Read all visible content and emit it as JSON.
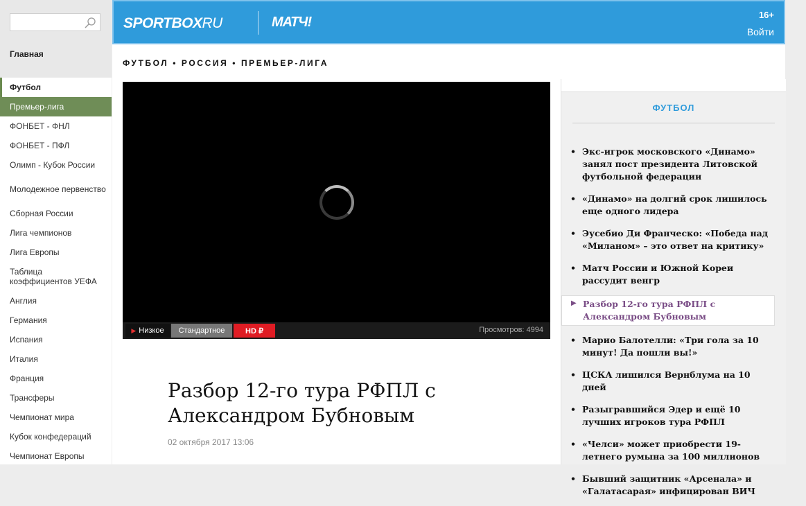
{
  "search": {
    "placeholder": ""
  },
  "sidebar": {
    "home": "Главная",
    "items": [
      {
        "label": "Футбол"
      },
      {
        "label": "Премьер-лига"
      },
      {
        "label": "ФОНБЕТ - ФНЛ"
      },
      {
        "label": "ФОНБЕТ - ПФЛ"
      },
      {
        "label": "Олимп - Кубок России"
      },
      {
        "label": "Молодежное первенство"
      },
      {
        "label": "Сборная России"
      },
      {
        "label": "Лига чемпионов"
      },
      {
        "label": "Лига Европы"
      },
      {
        "label": "Таблица коэффициентов УЕФА"
      },
      {
        "label": "Англия"
      },
      {
        "label": "Германия"
      },
      {
        "label": "Испания"
      },
      {
        "label": "Италия"
      },
      {
        "label": "Франция"
      },
      {
        "label": "Трансферы"
      },
      {
        "label": "Чемпионат мира"
      },
      {
        "label": "Кубок конфедераций"
      },
      {
        "label": "Чемпионат Европы"
      }
    ]
  },
  "header": {
    "logo_main": "SPORTBOX",
    "logo_suffix": "RU",
    "logo_partner": "МАТЧ!",
    "age_rating": "16+",
    "login": "Войти"
  },
  "breadcrumb": "ФУТБОЛ • РОССИЯ • ПРЕМЬЕР-ЛИГА",
  "video": {
    "quality_low": "Низкое",
    "quality_standard": "Стандартное",
    "quality_hd": "HD ₽",
    "views": "Просмотров: 4994"
  },
  "article": {
    "title": "Разбор 12-го тура РФПЛ с Александром Бубновым",
    "date": "02 октября 2017 13:06"
  },
  "news": {
    "heading": "ФУТБОЛ",
    "items": [
      {
        "title": "Экс-игрок московского «Динамо» занял пост президента Литовской футбольной федерации"
      },
      {
        "title": "«Динамо» на долгий срок лишилось еще одного лидера"
      },
      {
        "title": "Эусебио Ди Франческо: «Победа над «Миланом» – это ответ на критику»"
      },
      {
        "title": "Матч России и Южной Кореи рассудит венгр"
      },
      {
        "title": "Разбор 12-го тура РФПЛ с Александром Бубновым"
      },
      {
        "title": "Марио Балотелли: «Три гола за 10 минут! Да пошли вы!»"
      },
      {
        "title": "ЦСКА лишился Вернблума на 10 дней"
      },
      {
        "title": "Разыгравшийся Эдер и ещё 10 лучших игроков тура РФПЛ"
      },
      {
        "title": "«Челси» может приобрести 19-летнего румына за 100 миллионов"
      },
      {
        "title": "Бывший защитник «Арсенала» и «Галатасарая» инфицирован ВИЧ"
      }
    ]
  }
}
